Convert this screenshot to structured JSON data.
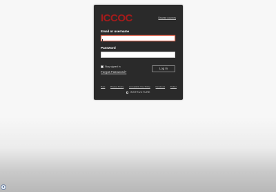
{
  "login": {
    "logo": "ICCOC",
    "browse_courses": "Browse courses",
    "email_label": "Email or username",
    "email_value": "",
    "email_placeholder": "",
    "password_label": "Password",
    "password_value": "",
    "stay_signed_in": "Stay signed in",
    "forgot_password": "Forgot Password?",
    "login_button": "Log In"
  },
  "footer": {
    "links": [
      "Help",
      "Privacy Policy",
      "Acceptable Use Policy",
      "Facebook",
      "Twitter"
    ],
    "brand": "INSTRUCTURE"
  },
  "colors": {
    "logo": "#a51b1b",
    "panel": "#2a2a2a",
    "focus_border": "#d8604a"
  },
  "icons": {
    "brand_icon": "instructure-logo-icon",
    "chat_icon": "chat-bubble-icon"
  }
}
